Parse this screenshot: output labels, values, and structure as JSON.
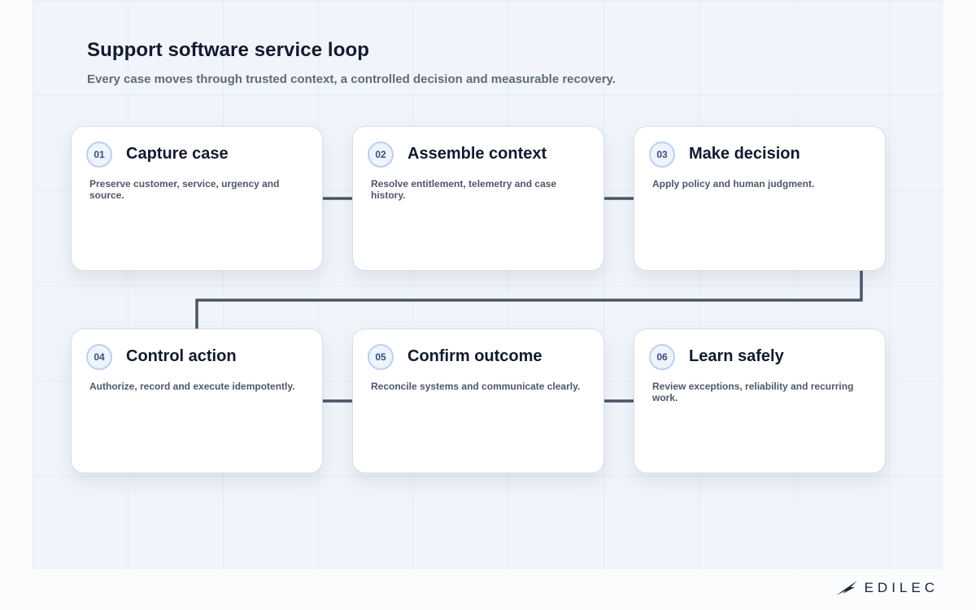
{
  "header": {
    "title": "Support software service loop",
    "subtitle": "Every case moves through trusted context, a controlled decision and measurable recovery."
  },
  "steps": [
    {
      "number": "01",
      "title": "Capture case",
      "description": "Preserve customer, service, urgency and source."
    },
    {
      "number": "02",
      "title": "Assemble context",
      "description": "Resolve entitlement, telemetry and case history."
    },
    {
      "number": "03",
      "title": "Make decision",
      "description": "Apply policy and human judgment."
    },
    {
      "number": "04",
      "title": "Control action",
      "description": "Authorize, record and execute idempotently."
    },
    {
      "number": "05",
      "title": "Confirm outcome",
      "description": "Reconcile systems and communicate clearly."
    },
    {
      "number": "06",
      "title": "Learn safely",
      "description": "Review exceptions, reliability and recurring work."
    }
  ],
  "brand": {
    "name": "EDILEC",
    "logo_icon": "bird-wing-logo-icon"
  },
  "colors": {
    "connector": "#4a5568",
    "badge_text": "#35507e",
    "title_text": "#121a2e"
  }
}
